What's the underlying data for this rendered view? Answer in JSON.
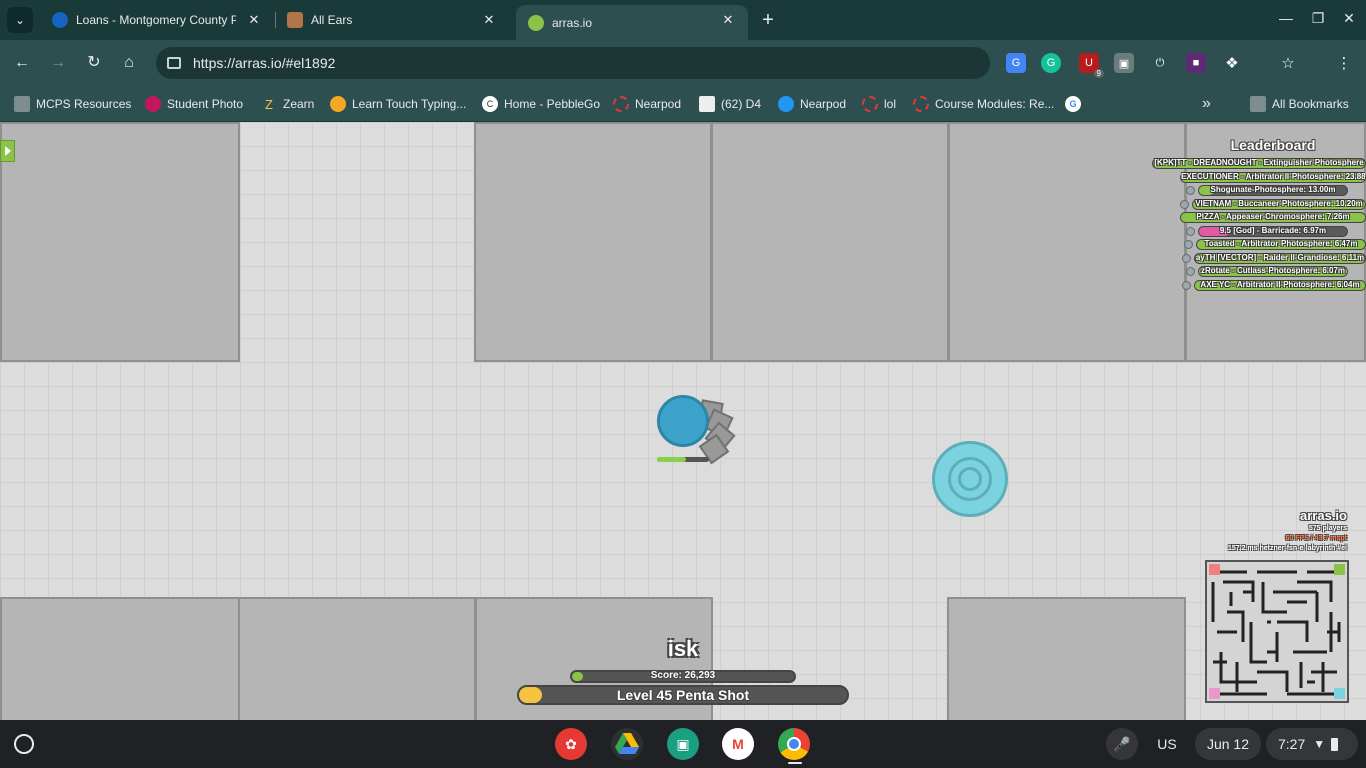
{
  "browser": {
    "tabs": [
      {
        "title": "Loans - Montgomery County P",
        "favicon_color": "#1565c0"
      },
      {
        "title": "All Ears",
        "favicon_color": "#b0754a"
      },
      {
        "title": "arras.io",
        "favicon_color": "#8bc34a"
      }
    ],
    "active_tab_index": 2,
    "url": "https://arras.io/#el1892",
    "extension_badge": "9",
    "bookmarks": [
      "MCPS Resources",
      "Student Photo",
      "Zearn",
      "Learn Touch Typing...",
      "Home - PebbleGo",
      "Nearpod",
      "(62) D4",
      "Nearpod",
      "lol",
      "Course Modules: Re...",
      ""
    ],
    "all_bookmarks": "All Bookmarks"
  },
  "game": {
    "leaderboard": {
      "title": "Leaderboard",
      "entries": [
        {
          "text": "[KPK]TT - DREADNOUGHT - Extinguisher-Photosphere",
          "fill": 1.0,
          "color": "#8bc34a"
        },
        {
          "text": "EXECUTIONER - Arbitrator II-Photosphere: 23.88m",
          "fill": 1.0,
          "color": "#8bc34a"
        },
        {
          "text": "Shogunate-Photosphere: 13.00m",
          "fill": 0.1,
          "color": "#8bc34a"
        },
        {
          "text": "VIETNAM - Buccaneer-Photosphere: 10.20m",
          "fill": 1.0,
          "color": "#8bc34a"
        },
        {
          "text": "PIZZA - Appeaser-Chromosphere: 7.26m",
          "fill": 1.0,
          "color": "#8bc34a"
        },
        {
          "text": "9.5 [God] - Barricade: 6.97m",
          "fill": 0.2,
          "color": "#e05aa5"
        },
        {
          "text": "Toasted - Arbitrator-Photosphere: 6.47m",
          "fill": 1.0,
          "color": "#8bc34a"
        },
        {
          "text": "ayTH [VECTOR] - Raider II-Grandiose: 6.11m",
          "fill": 1.0,
          "color": "#8bc34a"
        },
        {
          "text": "zRotate - Cutlass-Photosphere: 6.07m",
          "fill": 1.0,
          "color": "#8bc34a"
        },
        {
          "text": "AXE YC - Arbitrator II-Photosphere: 6.04m",
          "fill": 1.0,
          "color": "#8bc34a"
        }
      ]
    },
    "server": {
      "name": "arras.io",
      "players": "575 players",
      "fps": "60 FPS / 43.7 mspt",
      "ping": "157.2 ms  hetzner-fsn-e-labyrinth #el"
    },
    "player": {
      "name": "isk",
      "score_label": "Score: 26,293",
      "score_progress": 0.05,
      "level_label": "Level 45 Penta Shot",
      "level_progress": 0.07,
      "health": 0.55
    }
  },
  "shelf": {
    "apps": [
      {
        "name": "Canvas",
        "color": "#e53935"
      },
      {
        "name": "Google Drive",
        "color": "#34a853"
      },
      {
        "name": "Classroom",
        "color": "#1a9f83"
      },
      {
        "name": "Gmail",
        "color": "#ea4335"
      },
      {
        "name": "Chrome",
        "color": "#fbbc04"
      }
    ],
    "input_method": "US",
    "date": "Jun 12",
    "time": "7:27"
  }
}
